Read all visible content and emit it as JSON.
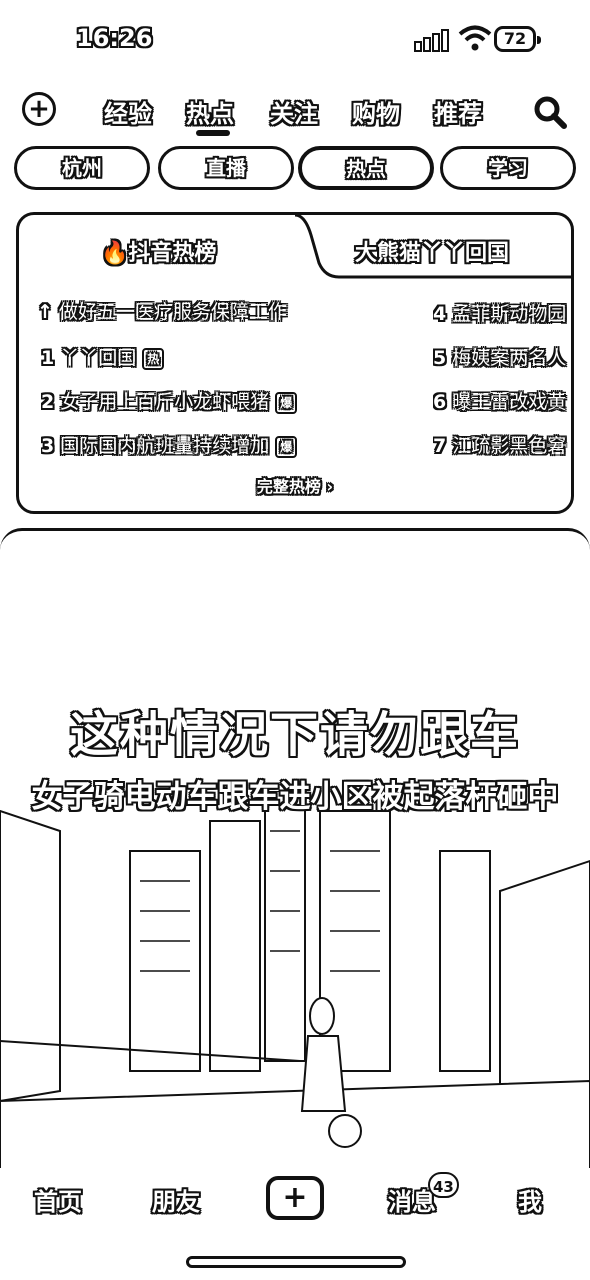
{
  "status_bar": {
    "time": "16:26",
    "battery": "72"
  },
  "top_nav": {
    "tabs": [
      {
        "label": "经验"
      },
      {
        "label": "热点"
      },
      {
        "label": "关注"
      },
      {
        "label": "购物"
      },
      {
        "label": "推荐"
      }
    ],
    "active_tab": "热点"
  },
  "chips": [
    {
      "label": "杭州"
    },
    {
      "label": "直播"
    },
    {
      "label": "热点"
    },
    {
      "label": "学习"
    }
  ],
  "hot_card": {
    "tab_active": "抖音热榜",
    "tab_other": "大熊猫丫丫回国",
    "pinned": "做好五一医疗服务保障工作",
    "left_items": [
      {
        "rank": "1",
        "text": "丫丫回国",
        "badge": "热"
      },
      {
        "rank": "2",
        "text": "女子用上百斤小龙虾喂猪",
        "badge": "爆"
      },
      {
        "rank": "3",
        "text": "国际国内航班量持续增加",
        "badge": "爆"
      }
    ],
    "right_items": [
      {
        "rank": "4",
        "text": "孟菲斯动物园"
      },
      {
        "rank": "5",
        "text": "梅姨案两名人"
      },
      {
        "rank": "6",
        "text": "曝王雷改戏黄"
      },
      {
        "rank": "7",
        "text": "江疏影黑色窘"
      }
    ],
    "more": "完整热榜"
  },
  "video": {
    "caption_main": "这种情况下请勿跟车",
    "caption_sub": "女子骑电动车跟车进小区被起落杆砸中"
  },
  "bottom_nav": {
    "home": "首页",
    "friends": "朋友",
    "messages": "消息",
    "messages_badge": "43",
    "me": "我"
  }
}
